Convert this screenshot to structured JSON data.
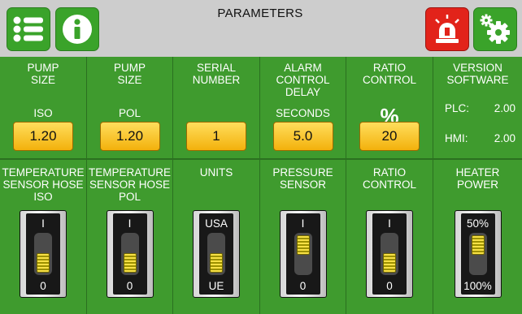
{
  "header": {
    "title": "PARAMETERS",
    "menu_icon": "list-menu-icon",
    "info_icon": "info-icon",
    "alarm_icon": "alarm-siren-icon",
    "settings_icon": "gear-icon"
  },
  "row1": [
    {
      "label": "PUMP\nSIZE",
      "sublabel": "ISO",
      "value": "1.20"
    },
    {
      "label": "PUMP\nSIZE",
      "sublabel": "POL",
      "value": "1.20"
    },
    {
      "label": "SERIAL\nNUMBER",
      "sublabel": "",
      "value": "1"
    },
    {
      "label": "ALARM\nCONTROL\nDELAY",
      "sublabel": "SECONDS",
      "value": "5.0"
    },
    {
      "label": "RATIO\nCONTROL",
      "sublabel": "%",
      "value": "20"
    }
  ],
  "version": {
    "label": "VERSION\nSOFTWARE",
    "plc_label": "PLC:",
    "plc_value": "2.00",
    "hmi_label": "HMI:",
    "hmi_value": "2.00"
  },
  "row2": [
    {
      "label": "TEMPERATURE\nSENSOR HOSE\nISO",
      "top": "I",
      "bottom": "0",
      "position": "bottom"
    },
    {
      "label": "TEMPERATURE\nSENSOR HOSE\nPOL",
      "top": "I",
      "bottom": "0",
      "position": "bottom"
    },
    {
      "label": "UNITS",
      "top": "USA",
      "bottom": "UE",
      "position": "bottom"
    },
    {
      "label": "PRESSURE\nSENSOR",
      "top": "I",
      "bottom": "0",
      "position": "top"
    },
    {
      "label": "RATIO\nCONTROL",
      "top": "I",
      "bottom": "0",
      "position": "bottom"
    },
    {
      "label": "HEATER\nPOWER",
      "top": "50%",
      "bottom": "100%",
      "position": "top"
    }
  ],
  "colors": {
    "panel_green": "#3f9b2e",
    "divider_green": "#2b7020",
    "value_yellow": "#f3b10c",
    "alarm_red": "#e2231a"
  }
}
